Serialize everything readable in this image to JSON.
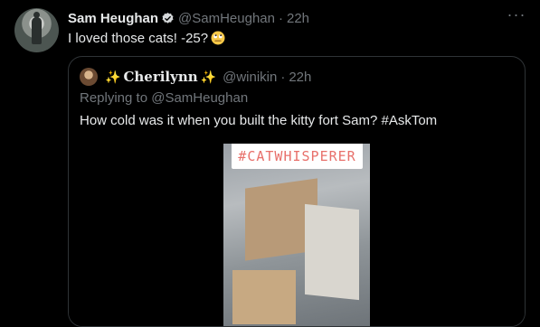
{
  "tweet": {
    "author_name": "Sam Heughan",
    "handle": "@SamHeughan",
    "separator": "·",
    "time": "22h",
    "text": "I loved those cats! -25?",
    "more_label": "···",
    "avatar_icon": "user-avatar-photo",
    "verified_icon": "verified-badge-icon",
    "emoji_icon": "face-with-rolling-eyes-emoji"
  },
  "quoted": {
    "author_name": "Cherilynn",
    "sparkle": "✨",
    "handle": "@winikin",
    "separator": "·",
    "time": "22h",
    "reply_prefix": "Replying to",
    "reply_to": "@SamHeughan",
    "text": "How cold was it when you built the kitty fort Sam? #AskTom",
    "media_caption": "#CATWHISPERER"
  },
  "colors": {
    "background": "#000000",
    "text_primary": "#e7e9ea",
    "text_secondary": "#71767b",
    "verified": "#d6d9db",
    "border": "#2f3336",
    "caption": "#e8706b"
  }
}
